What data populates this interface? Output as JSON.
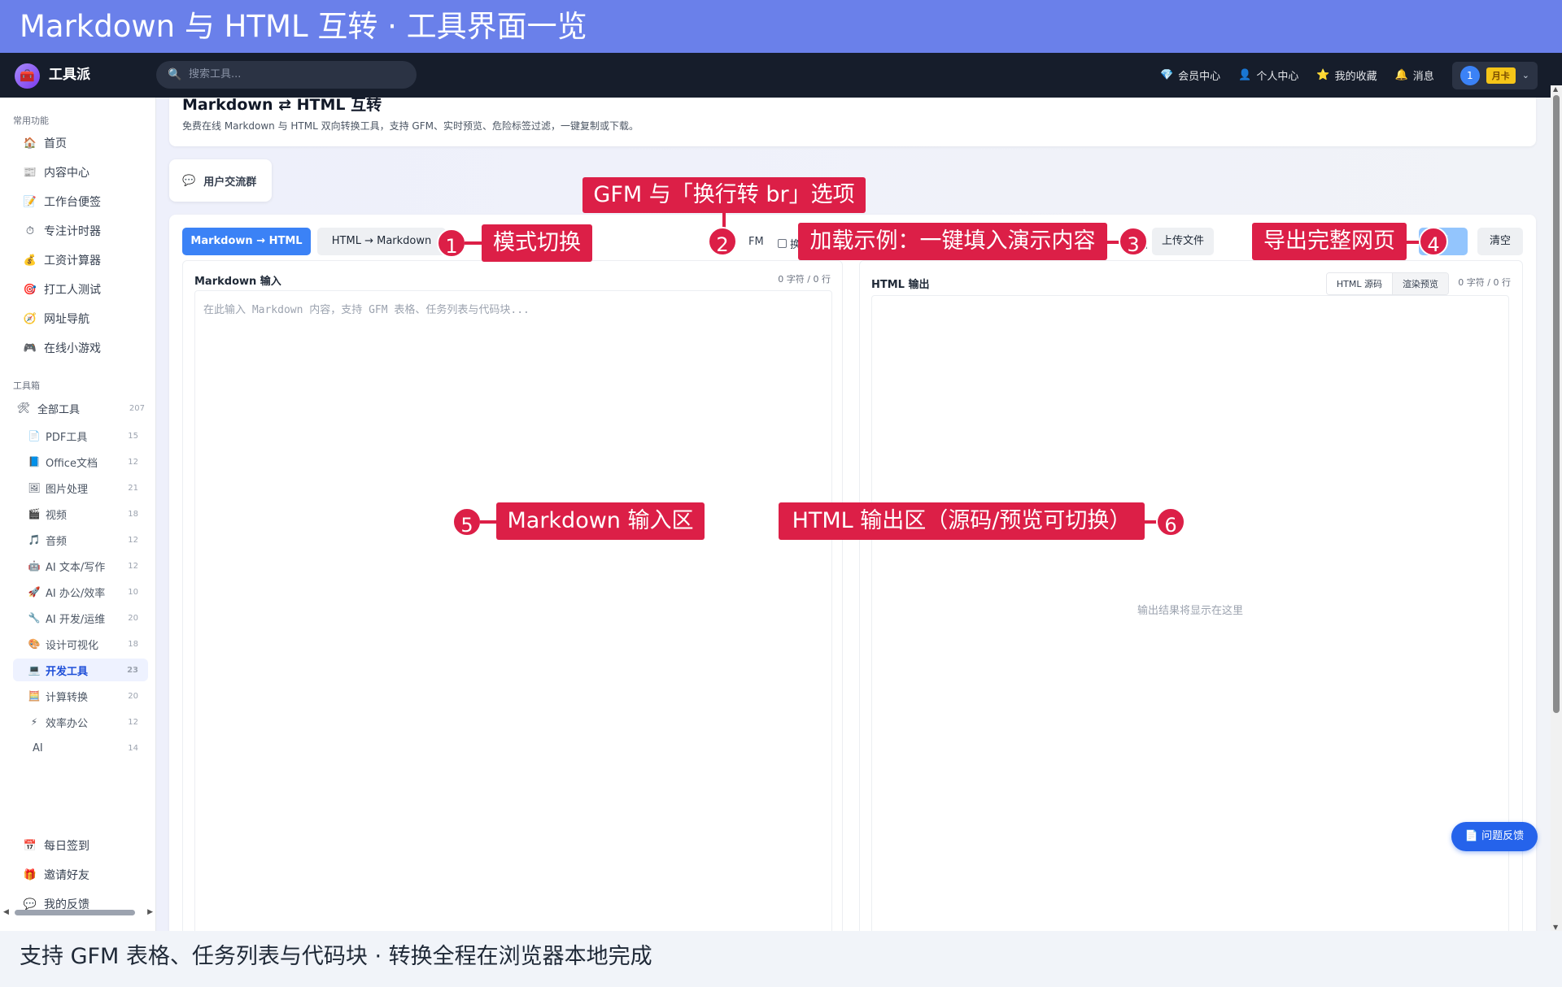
{
  "banner": {
    "title": "Markdown 与 HTML 互转 · 工具界面一览"
  },
  "nav": {
    "logo": "工具派",
    "search_placeholder": "搜索工具...",
    "items": [
      "会员中心",
      "个人中心",
      "我的收藏",
      "消息"
    ],
    "user_initial": "1",
    "badge": "月卡"
  },
  "sidebar": {
    "section1": "常用功能",
    "common": [
      {
        "icon": "🏠",
        "label": "首页"
      },
      {
        "icon": "📰",
        "label": "内容中心"
      },
      {
        "icon": "📝",
        "label": "工作台便签"
      },
      {
        "icon": "⏱",
        "label": "专注计时器"
      },
      {
        "icon": "💰",
        "label": "工资计算器"
      },
      {
        "icon": "🎯",
        "label": "打工人测试"
      },
      {
        "icon": "🧭",
        "label": "网址导航"
      },
      {
        "icon": "🎮",
        "label": "在线小游戏"
      }
    ],
    "section2": "工具箱",
    "all": {
      "label": "全部工具",
      "count": "207"
    },
    "categories": [
      {
        "icon": "📄",
        "label": "PDF工具",
        "count": "15"
      },
      {
        "icon": "📘",
        "label": "Office文档",
        "count": "12"
      },
      {
        "icon": "🖼",
        "label": "图片处理",
        "count": "21"
      },
      {
        "icon": "🎬",
        "label": "视频",
        "count": "18"
      },
      {
        "icon": "🎵",
        "label": "音频",
        "count": "12"
      },
      {
        "icon": "🤖",
        "label": "AI 文本/写作",
        "count": "12"
      },
      {
        "icon": "🚀",
        "label": "AI 办公/效率",
        "count": "10"
      },
      {
        "icon": "🔧",
        "label": "AI 开发/运维",
        "count": "20"
      },
      {
        "icon": "🎨",
        "label": "设计可视化",
        "count": "18"
      },
      {
        "icon": "💻",
        "label": "开发工具",
        "count": "23"
      },
      {
        "icon": "🧮",
        "label": "计算转换",
        "count": "20"
      },
      {
        "icon": "⚡",
        "label": "效率办公",
        "count": "12"
      },
      {
        "icon": "",
        "label": "AI",
        "count": "14"
      }
    ],
    "bottom": [
      {
        "icon": "📅",
        "label": "每日签到"
      },
      {
        "icon": "🎁",
        "label": "邀请好友"
      },
      {
        "icon": "💬",
        "label": "我的反馈"
      }
    ]
  },
  "page": {
    "title": "Markdown ⇄ HTML 互转",
    "subtitle": "免费在线 Markdown 与 HTML 双向转换工具，支持 GFM、实时预览、危险标签过滤，一键复制或下载。",
    "group": "用户交流群"
  },
  "toolbar": {
    "mode_md2html": "Markdown → HTML",
    "mode_html2md": "HTML → Markdown",
    "gfm_partial": "FM",
    "br_partial": "换行",
    "example_partial": "例",
    "upload": "上传文件",
    "export_partial": "页",
    "clear": "清空"
  },
  "input_panel": {
    "title": "Markdown 输入",
    "count": "0 字符 / 0 行",
    "placeholder": "在此输入 Markdown 内容，支持 GFM 表格、任务列表与代码块..."
  },
  "output_panel": {
    "title": "HTML 输出",
    "tab_source": "HTML 源码",
    "tab_preview": "渲染预览",
    "count": "0 字符 / 0 行",
    "placeholder": "输出结果将显示在这里"
  },
  "feedback": "问题反馈",
  "annotations": [
    {
      "n": "1",
      "text": "模式切换"
    },
    {
      "n": "2",
      "text": "GFM 与「换行转 br」选项"
    },
    {
      "n": "3",
      "text": "加载示例：一键填入演示内容"
    },
    {
      "n": "4",
      "text": "导出完整网页"
    },
    {
      "n": "5",
      "text": "Markdown 输入区"
    },
    {
      "n": "6",
      "text": "HTML 输出区（源码/预览可切换）"
    }
  ],
  "caption": "支持 GFM 表格、任务列表与代码块 · 转换全程在浏览器本地完成",
  "colors": {
    "banner": "#6a80ea",
    "nav": "#161d2b",
    "accent": "#3b82f6",
    "annotation": "#dc1f47"
  }
}
